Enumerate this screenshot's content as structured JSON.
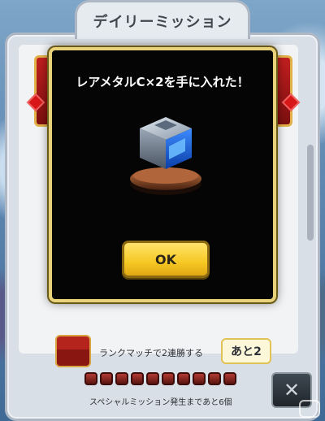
{
  "screen": {
    "title": "デイリーミッション"
  },
  "modal": {
    "message": "レアメタルC×2を手に入れた！",
    "ok_label": "OK",
    "item_icon": "rare-metal-cube-icon"
  },
  "mission": {
    "label": "ランクマッチで2連勝する",
    "remaining": "あと2"
  },
  "special": {
    "progress_text": "スペシャルミッション発生まであと6個",
    "tokens_total": 10
  },
  "close_icon": "close-icon",
  "colors": {
    "modal_border": "#e8d37a",
    "ok_button": "#f6c823",
    "ribbon_red": "#c21f1f"
  }
}
